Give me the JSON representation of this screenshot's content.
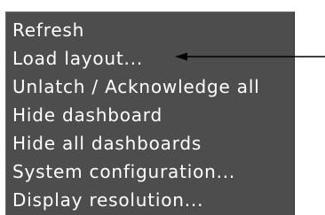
{
  "context_menu": {
    "items": [
      {
        "label": "Refresh"
      },
      {
        "label": "Load layout..."
      },
      {
        "label": "Unlatch / Acknowledge all"
      },
      {
        "label": "Hide dashboard"
      },
      {
        "label": "Hide all dashboards"
      },
      {
        "label": "System configuration..."
      },
      {
        "label": "Display resolution..."
      }
    ]
  },
  "colors": {
    "menu_background": "#4d4d4d",
    "menu_text": "#ffffff",
    "annotation_arrow": "#000000",
    "page_background": "#ffffff"
  }
}
